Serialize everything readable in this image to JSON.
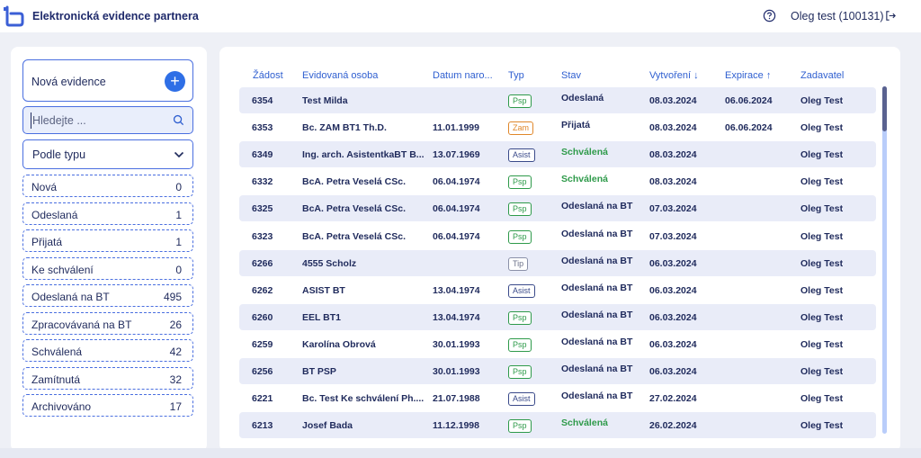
{
  "header": {
    "app_title": "Elektronická evidence partnera",
    "user": "Oleg test (100131)"
  },
  "sidebar": {
    "new_label": "Nová evidence",
    "search_placeholder": "Hledejte ...",
    "type_label": "Podle typu",
    "statuses": [
      {
        "label": "Nová",
        "count": "0"
      },
      {
        "label": "Odeslaná",
        "count": "1"
      },
      {
        "label": "Přijatá",
        "count": "1"
      },
      {
        "label": "Ke schválení",
        "count": "0"
      },
      {
        "label": "Odeslaná na BT",
        "count": "495"
      },
      {
        "label": "Zpracovávaná na BT",
        "count": "26"
      },
      {
        "label": "Schválená",
        "count": "42"
      },
      {
        "label": "Zamítnutá",
        "count": "32"
      },
      {
        "label": "Archivováno",
        "count": "17"
      }
    ]
  },
  "table": {
    "columns": {
      "zadost": "Žádost",
      "osoba": "Evidovaná osoba",
      "datum": "Datum naro...",
      "typ": "Typ",
      "stav": "Stav",
      "vytvoreni": "Vytvoření ↓",
      "expirace": "Expirace ↑",
      "zadavatel": "Zadavatel"
    },
    "rows": [
      {
        "id": "6354",
        "osoba": "Test Milda",
        "datum": "",
        "typ": "Psp",
        "stav": "Odeslaná",
        "vytvoreni": "08.03.2024",
        "expirace": "06.06.2024",
        "zadavatel": "Oleg Test"
      },
      {
        "id": "6353",
        "osoba": "Bc. ZAM BT1 Th.D.",
        "datum": "11.01.1999",
        "typ": "Zam",
        "stav": "Přijatá",
        "vytvoreni": "08.03.2024",
        "expirace": "06.06.2024",
        "zadavatel": "Oleg Test"
      },
      {
        "id": "6349",
        "osoba": "Ing. arch. AsistentkaBT B...",
        "datum": "13.07.1969",
        "typ": "Asist",
        "stav": "Schválená",
        "vytvoreni": "08.03.2024",
        "expirace": "",
        "zadavatel": "Oleg Test"
      },
      {
        "id": "6332",
        "osoba": "BcA. Petra Veselá CSc.",
        "datum": "06.04.1974",
        "typ": "Psp",
        "stav": "Schválená",
        "vytvoreni": "08.03.2024",
        "expirace": "",
        "zadavatel": "Oleg Test"
      },
      {
        "id": "6325",
        "osoba": "BcA. Petra Veselá CSc.",
        "datum": "06.04.1974",
        "typ": "Psp",
        "stav": "Odeslaná na BT",
        "vytvoreni": "07.03.2024",
        "expirace": "",
        "zadavatel": "Oleg Test"
      },
      {
        "id": "6323",
        "osoba": "BcA. Petra Veselá CSc.",
        "datum": "06.04.1974",
        "typ": "Psp",
        "stav": "Odeslaná na BT",
        "vytvoreni": "07.03.2024",
        "expirace": "",
        "zadavatel": "Oleg Test"
      },
      {
        "id": "6266",
        "osoba": "4555 Scholz",
        "datum": "",
        "typ": "Tip",
        "stav": "Odeslaná na BT",
        "vytvoreni": "06.03.2024",
        "expirace": "",
        "zadavatel": "Oleg Test"
      },
      {
        "id": "6262",
        "osoba": "ASIST BT",
        "datum": "13.04.1974",
        "typ": "Asist",
        "stav": "Odeslaná na BT",
        "vytvoreni": "06.03.2024",
        "expirace": "",
        "zadavatel": "Oleg Test"
      },
      {
        "id": "6260",
        "osoba": "EEL BT1",
        "datum": "13.04.1974",
        "typ": "Psp",
        "stav": "Odeslaná na BT",
        "vytvoreni": "06.03.2024",
        "expirace": "",
        "zadavatel": "Oleg Test"
      },
      {
        "id": "6259",
        "osoba": "Karolína Obrová",
        "datum": "30.01.1993",
        "typ": "Psp",
        "stav": "Odeslaná na BT",
        "vytvoreni": "06.03.2024",
        "expirace": "",
        "zadavatel": "Oleg Test"
      },
      {
        "id": "6256",
        "osoba": "BT PSP",
        "datum": "30.01.1993",
        "typ": "Psp",
        "stav": "Odeslaná na BT",
        "vytvoreni": "06.03.2024",
        "expirace": "",
        "zadavatel": "Oleg Test"
      },
      {
        "id": "6221",
        "osoba": "Bc. Test Ke schválení Ph....",
        "datum": "21.07.1988",
        "typ": "Asist",
        "stav": "Odeslaná na BT",
        "vytvoreni": "27.02.2024",
        "expirace": "",
        "zadavatel": "Oleg Test"
      },
      {
        "id": "6213",
        "osoba": "Josef Bada",
        "datum": "11.12.1998",
        "typ": "Psp",
        "stav": "Schválená",
        "vytvoreni": "26.02.2024",
        "expirace": "",
        "zadavatel": "Oleg Test"
      }
    ]
  },
  "colors": {
    "accent": "#2f6fe6",
    "header_text": "#2f5fd0",
    "approved": "#2e9a4a",
    "row_shade": "#e9ecf8"
  }
}
